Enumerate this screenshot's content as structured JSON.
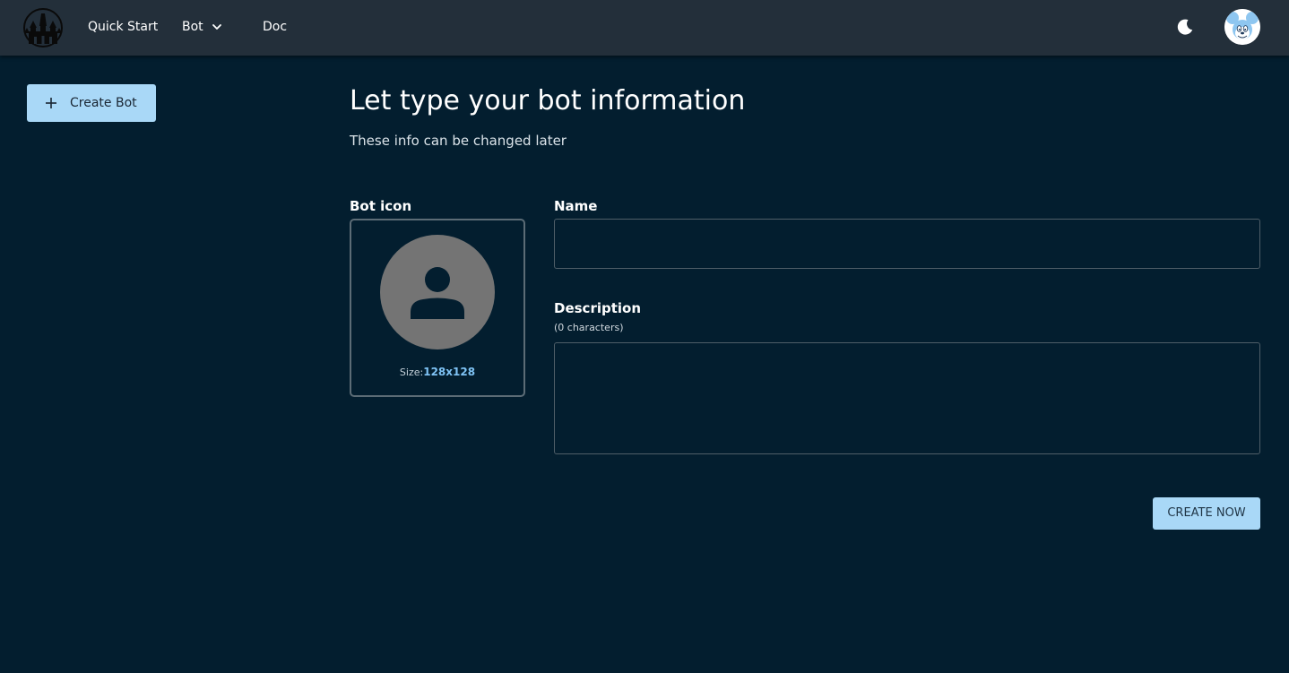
{
  "nav": {
    "logo_icon": "castle-logo-icon",
    "items": [
      {
        "label": "Quick Start"
      },
      {
        "label": "Bot",
        "icon": "chevron-down-icon"
      },
      {
        "label": "Doc"
      }
    ],
    "theme_toggle_icon": "moon-icon",
    "avatar_icon": "mouse-character-avatar"
  },
  "sidebar": {
    "create_bot_label": "Create Bot",
    "create_bot_icon": "plus-icon"
  },
  "main": {
    "title": "Let type your bot information",
    "subtitle": "These info can be changed later",
    "bot_icon": {
      "label": "Bot icon",
      "placeholder_icon": "person-icon",
      "size_prefix": "Size:",
      "size_value": "128x128"
    },
    "name": {
      "label": "Name",
      "value": ""
    },
    "description": {
      "label": "Description",
      "count": "(0 characters)",
      "value": ""
    },
    "submit_label": "CREATE NOW"
  },
  "colors": {
    "background": "#031e2f",
    "topbar": "#232f3a",
    "accent_button": "#a9d8f7",
    "size_highlight": "#7fc3f5",
    "placeholder_circle": "#747474"
  }
}
